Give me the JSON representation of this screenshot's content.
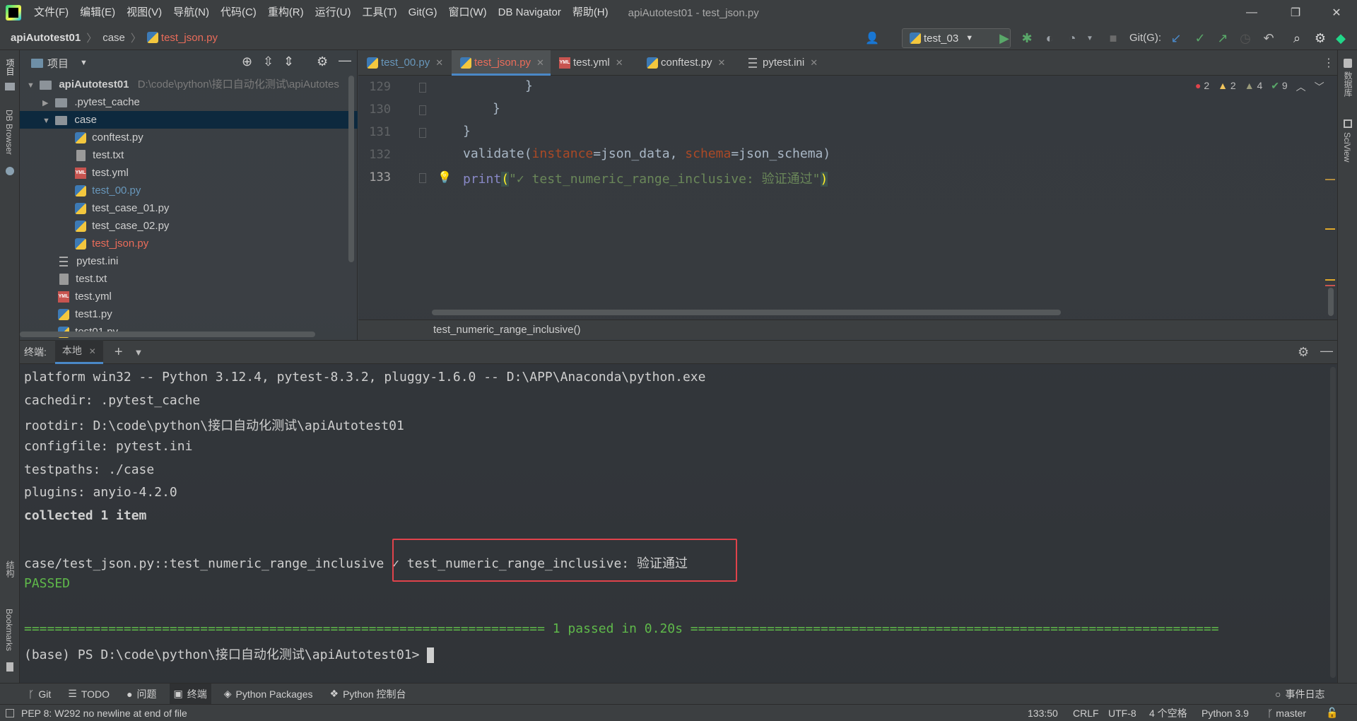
{
  "titlebar": {
    "menus": [
      "文件(F)",
      "编辑(E)",
      "视图(V)",
      "导航(N)",
      "代码(C)",
      "重构(R)",
      "运行(U)",
      "工具(T)",
      "Git(G)",
      "窗口(W)",
      "DB Navigator",
      "帮助(H)"
    ],
    "window_title": "apiAutotest01 - test_json.py"
  },
  "navbar": {
    "project": "apiAutotest01",
    "folder": "case",
    "file": "test_json.py",
    "run_config": "test_03",
    "git_label": "Git(G):"
  },
  "left_strip": {
    "project": "项目",
    "db_browser": "DB Browser",
    "structure": "结构",
    "bookmarks": "Bookmarks"
  },
  "right_strip": {
    "database": "数据库",
    "sciview": "SciView"
  },
  "project_panel": {
    "title": "项目",
    "root": "apiAutotest01",
    "root_path": "D:\\code\\python\\接口自动化测试\\apiAutotes",
    "items": [
      {
        "label": ".pytest_cache"
      },
      {
        "label": "case"
      },
      {
        "label": "conftest.py"
      },
      {
        "label": "test.txt"
      },
      {
        "label": "test.yml"
      },
      {
        "label": "test_00.py"
      },
      {
        "label": "test_case_01.py"
      },
      {
        "label": "test_case_02.py"
      },
      {
        "label": "test_json.py"
      },
      {
        "label": "pytest.ini"
      },
      {
        "label": "test.txt"
      },
      {
        "label": "test.yml"
      },
      {
        "label": "test1.py"
      },
      {
        "label": "test01.py"
      }
    ]
  },
  "editor": {
    "tabs": [
      "test_00.py",
      "test_json.py",
      "test.yml",
      "conftest.py",
      "pytest.ini"
    ],
    "inspections": {
      "errors": "2",
      "warnings": "2",
      "weak": "4",
      "ok": "9"
    },
    "lines": [
      {
        "num": "129",
        "text": "}"
      },
      {
        "num": "130",
        "text": "}"
      },
      {
        "num": "131",
        "text": "}"
      },
      {
        "num": "132",
        "fn": "validate(",
        "p1": "instance",
        "a1": "=json_data, ",
        "p2": "schema",
        "a2": "=json_schema)"
      },
      {
        "num": "133",
        "fn": "print",
        "open": "(",
        "str": "\"✓ test_numeric_range_inclusive: 验证通过\"",
        "close": ")"
      }
    ],
    "breadcrumb_function": "test_numeric_range_inclusive()"
  },
  "terminal": {
    "label": "终端:",
    "tab": "本地",
    "lines": [
      "platform win32 -- Python 3.12.4, pytest-8.3.2, pluggy-1.6.0 -- D:\\APP\\Anaconda\\python.exe",
      "cachedir: .pytest_cache",
      "rootdir: D:\\code\\python\\接口自动化测试\\apiAutotest01",
      "configfile: pytest.ini",
      "testpaths: ./case",
      "plugins: anyio-4.2.0",
      "collected 1 item"
    ],
    "test_line": "case/test_json.py::test_numeric_range_inclusive",
    "test_output": "✓ test_numeric_range_inclusive: 验证通过",
    "passed": "PASSED",
    "summary": "==================================================================== 1 passed in 0.20s =====================================================================",
    "prompt": "(base) PS D:\\code\\python\\接口自动化测试\\apiAutotest01>"
  },
  "tool_windows": [
    "Git",
    "TODO",
    "问题",
    "终端",
    "Python Packages",
    "Python 控制台"
  ],
  "event_log": "事件日志",
  "statusbar": {
    "message": "PEP 8: W292 no newline at end of file",
    "position": "133:50",
    "line_sep": "CRLF",
    "encoding": "UTF-8",
    "indent": "4 个空格",
    "interpreter": "Python 3.9",
    "branch": "master"
  },
  "colors": {
    "accent": "#4a88c7",
    "error": "#e0434b",
    "pass": "#5fb94a",
    "modified_file": "#ea6c5a",
    "new_file": "#6897bb"
  }
}
